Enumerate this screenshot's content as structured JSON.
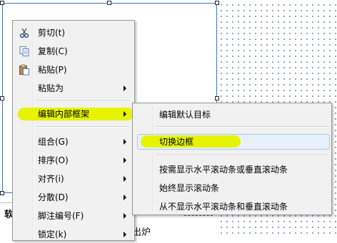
{
  "context_menu": {
    "items": [
      {
        "label": "剪切(t)",
        "icon": "scissors-icon",
        "submenu": false
      },
      {
        "label": "复制(C)",
        "icon": "copy-icon",
        "submenu": false
      },
      {
        "label": "粘贴(P)",
        "icon": "paste-icon",
        "submenu": false
      },
      {
        "label": "粘贴为",
        "icon": "",
        "submenu": true
      },
      {
        "label": "编辑内部框架",
        "icon": "",
        "submenu": true,
        "highlighted": true
      },
      {
        "label": "组合(G)",
        "icon": "",
        "submenu": true
      },
      {
        "label": "排序(O)",
        "icon": "",
        "submenu": true
      },
      {
        "label": "对齐(i)",
        "icon": "",
        "submenu": true
      },
      {
        "label": "分散(D)",
        "icon": "",
        "submenu": true
      },
      {
        "label": "脚注编号(F)",
        "icon": "",
        "submenu": true
      },
      {
        "label": "锁定(k)",
        "icon": "",
        "submenu": true
      }
    ]
  },
  "submenu": {
    "items": [
      {
        "label": "编辑默认目标"
      },
      {
        "label": "切换边框",
        "highlighted": true
      },
      {
        "label": "按需显示水平滚动条或垂直滚动条"
      },
      {
        "label": "始终显示滚动条"
      },
      {
        "label": "从不显示水平滚动条和垂直滚动条"
      }
    ]
  },
  "document": {
    "left_text": "软",
    "right_text": "出炉"
  },
  "colors": {
    "highlight": "#e6f400",
    "menu_bg": "#f1f1f1",
    "hover_bg": "#e8f0fb"
  }
}
